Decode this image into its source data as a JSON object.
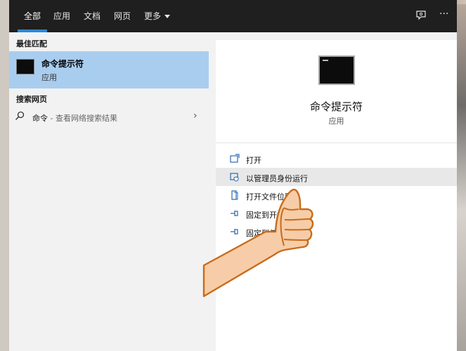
{
  "tabs": [
    {
      "label": "全部"
    },
    {
      "label": "应用"
    },
    {
      "label": "文档"
    },
    {
      "label": "网页"
    },
    {
      "label": "更多"
    }
  ],
  "top_icons": {
    "feedback": "feedback-icon",
    "more": "···"
  },
  "left": {
    "best_match_title": "最佳匹配",
    "best_match": {
      "name": "命令提示符",
      "type": "应用"
    },
    "web_title": "搜索网页",
    "web_item": {
      "query": "命令",
      "hint": " - 查看网络搜索结果"
    }
  },
  "right": {
    "app_name": "命令提示符",
    "app_type": "应用",
    "actions": [
      {
        "label": "打开",
        "icon": "open-icon"
      },
      {
        "label": "以管理员身份运行",
        "icon": "shield-icon"
      },
      {
        "label": "打开文件位置",
        "icon": "folder-icon"
      },
      {
        "label": "固定到开始屏幕",
        "icon": "pin-icon"
      },
      {
        "label": "固定到任务栏",
        "icon": "pin-icon"
      }
    ]
  },
  "colors": {
    "accent": "#2b88d8",
    "selected": "#a9cdef",
    "topbar": "#1f1f1f"
  }
}
